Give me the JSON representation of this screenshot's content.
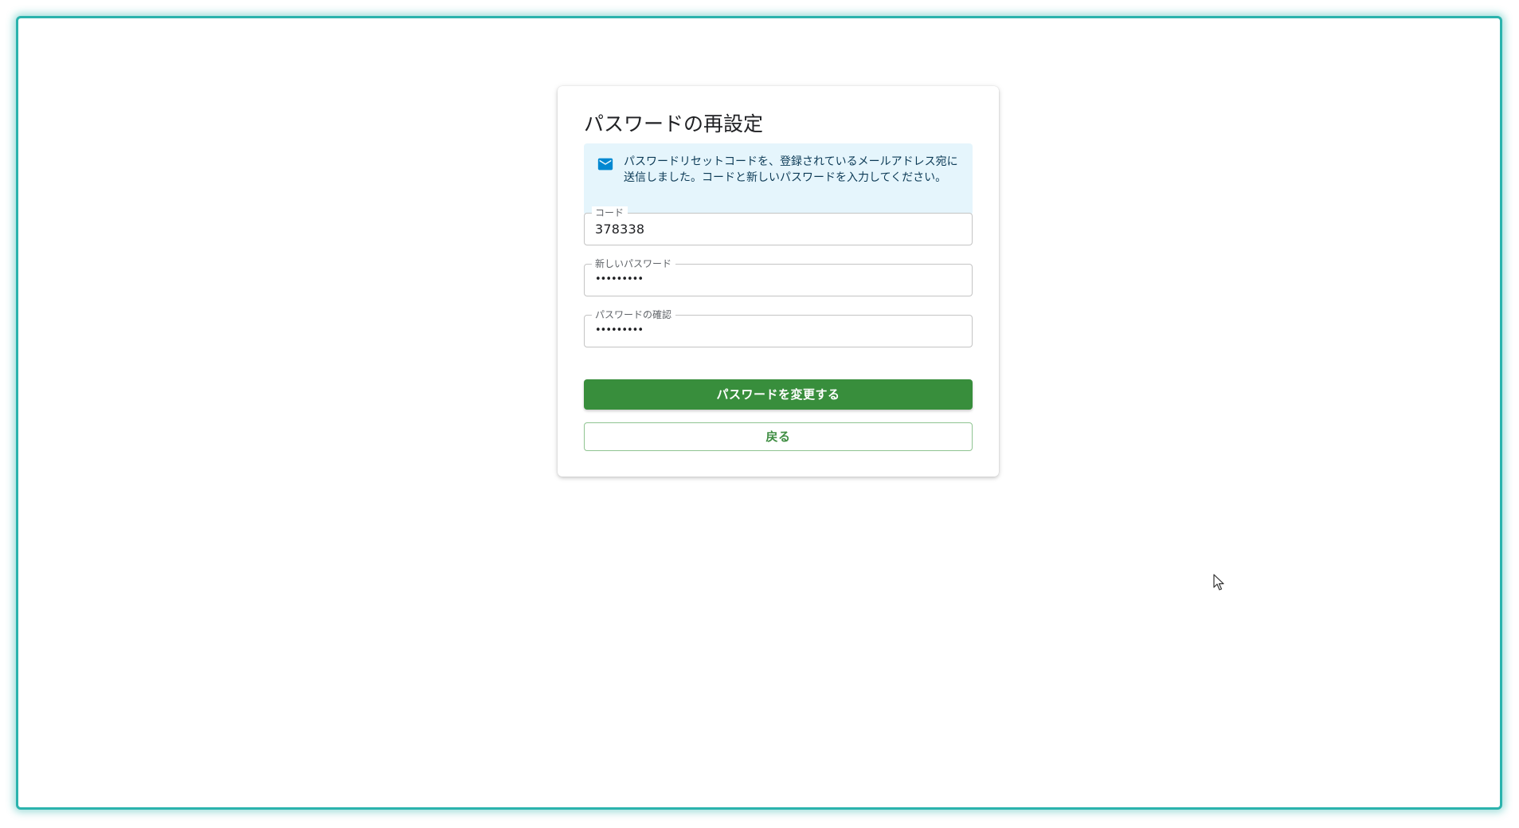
{
  "form": {
    "title": "パスワードの再設定",
    "alert": {
      "icon": "mail-icon",
      "color": "#0288d1",
      "message": "パスワードリセットコードを、登録されているメールアドレス宛に送信しました。コードと新しいパスワードを入力してください。"
    },
    "code_field": {
      "label": "コード",
      "value": "378338"
    },
    "new_password_field": {
      "label": "新しいパスワード",
      "value": "•••••••••"
    },
    "confirm_password_field": {
      "label": "パスワードの確認",
      "value": "•••••••••"
    },
    "submit_label": "パスワードを変更する",
    "back_label": "戻る"
  },
  "theme": {
    "accent": "#388e3c",
    "frame": "#2bb3ad"
  }
}
